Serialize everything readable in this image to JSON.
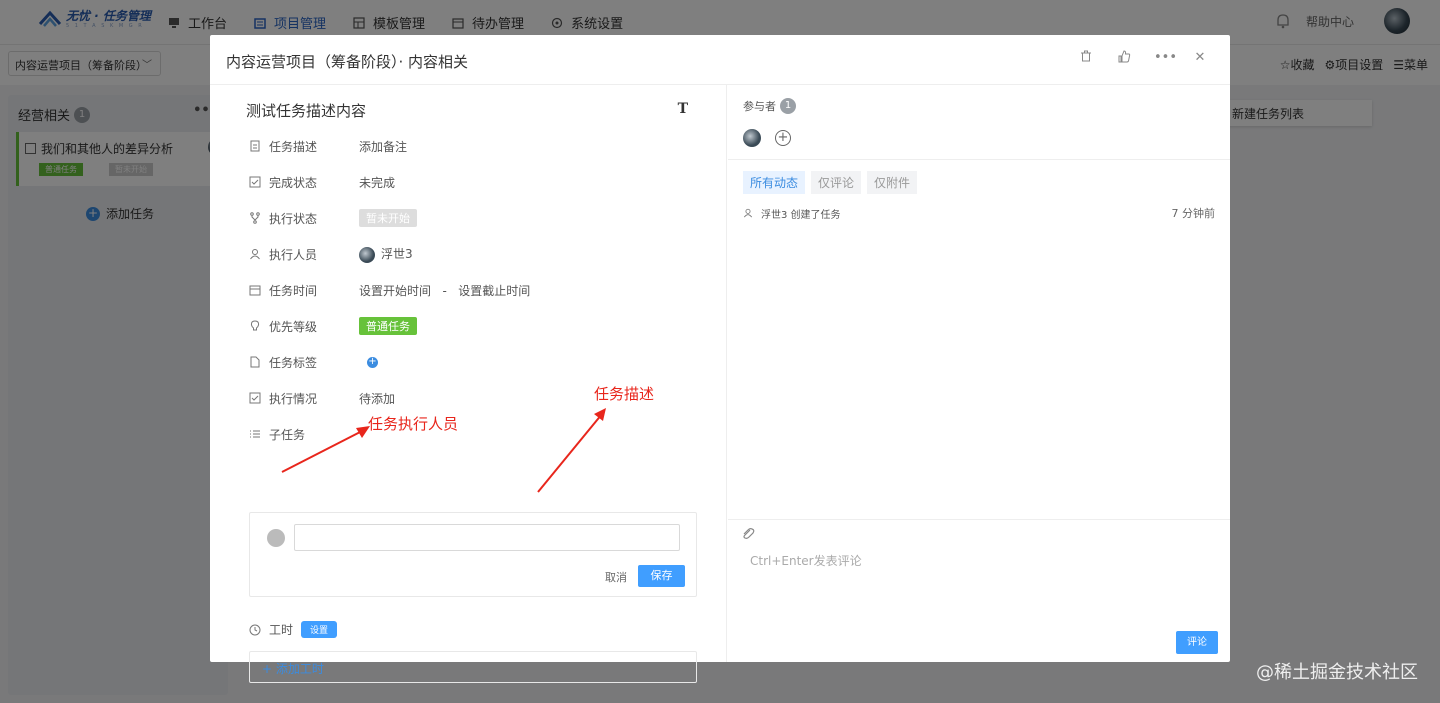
{
  "brand": {
    "title": "无忧 · 任务管理",
    "subtitle": "5 1 T A S K M G R"
  },
  "nav": [
    {
      "label": "工作台",
      "icon": "monitor-icon",
      "active": false
    },
    {
      "label": "项目管理",
      "icon": "folder-icon",
      "active": true
    },
    {
      "label": "模板管理",
      "icon": "grid-icon",
      "active": false
    },
    {
      "label": "待办管理",
      "icon": "calendar-icon",
      "active": false
    },
    {
      "label": "系统设置",
      "icon": "gear-icon",
      "active": false
    }
  ],
  "topRight": {
    "help": "帮助中心"
  },
  "subbar": {
    "project": "内容运营项目（筹备阶段）",
    "actions": [
      "☆收藏",
      "⚙项目设置",
      "☰菜单"
    ]
  },
  "board": {
    "column1": {
      "title": "经营相关",
      "count": "1",
      "card": {
        "title": "我们和其他人的差异分析",
        "tag1": "普通任务",
        "tag2": "暂未开始"
      },
      "addTask": "添加任务"
    },
    "newList": "新建任务列表"
  },
  "modal": {
    "title": "内容运营项目（筹备阶段）· 内容相关",
    "taskTitle": "测试任务描述内容",
    "fields": {
      "desc": {
        "label": "任务描述",
        "value": "添加备注"
      },
      "done": {
        "label": "完成状态",
        "value": "未完成"
      },
      "exec": {
        "label": "执行状态",
        "value": "暂未开始"
      },
      "person": {
        "label": "执行人员",
        "value": "浮世3"
      },
      "time": {
        "label": "任务时间",
        "value": "设置开始时间   -   设置截止时间"
      },
      "priority": {
        "label": "优先等级",
        "value": "普通任务"
      },
      "tags": {
        "label": "任务标签"
      },
      "progress": {
        "label": "执行情况",
        "value": "待添加"
      },
      "subtask": {
        "label": "子任务"
      }
    },
    "subtaskBox": {
      "cancel": "取消",
      "save": "保存"
    },
    "hours": {
      "label": "工时",
      "set": "设置",
      "add": "+ 添加工时"
    },
    "participants": {
      "label": "参与者",
      "count": "1"
    },
    "filters": [
      "所有动态",
      "仅评论",
      "仅附件"
    ],
    "activity": {
      "text": "浮世3 创建了任务",
      "time": "7 分钟前"
    },
    "comment": {
      "placeholder": "Ctrl+Enter发表评论",
      "submit": "评论"
    }
  },
  "annotations": {
    "person": "任务执行人员",
    "desc": "任务描述"
  },
  "watermark": "@稀土掘金技术社区",
  "colors": {
    "primary": "#409eff",
    "green": "#67c23a",
    "annotation": "#e8261c"
  }
}
